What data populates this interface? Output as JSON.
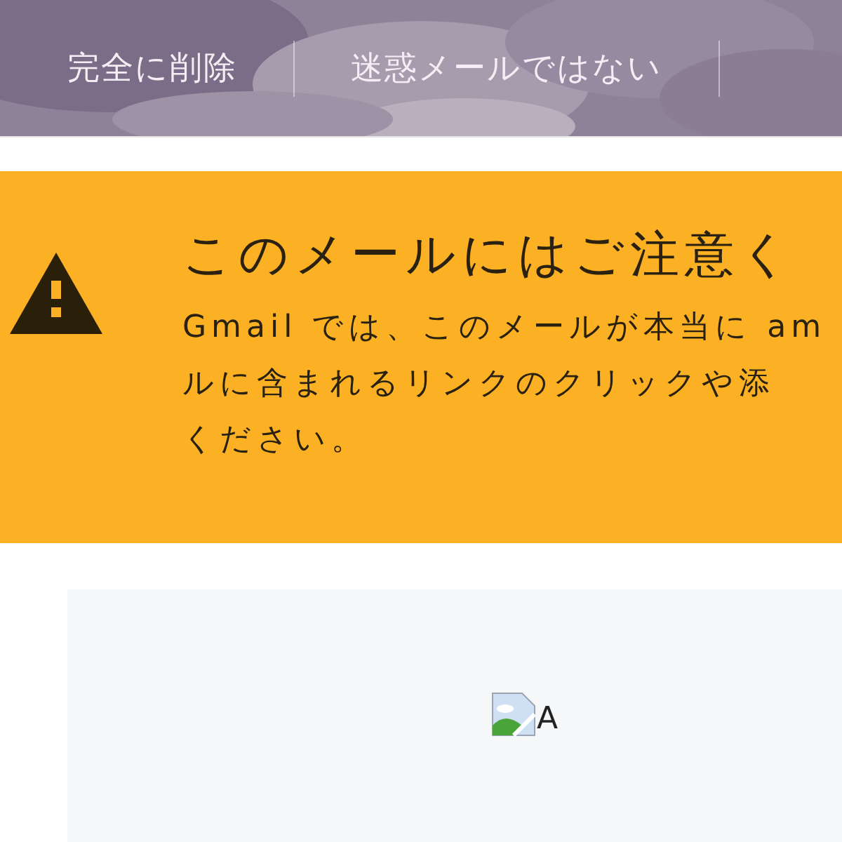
{
  "toolbar": {
    "buttons": [
      "完全に削除",
      "迷惑メールではない"
    ]
  },
  "warning": {
    "title": "このメールにはご注意く",
    "lines": [
      "Gmail では、このメールが本当に am",
      "ルに含まれるリンクのクリックや添",
      "ください。"
    ]
  },
  "content": {
    "image_alt": "A"
  }
}
